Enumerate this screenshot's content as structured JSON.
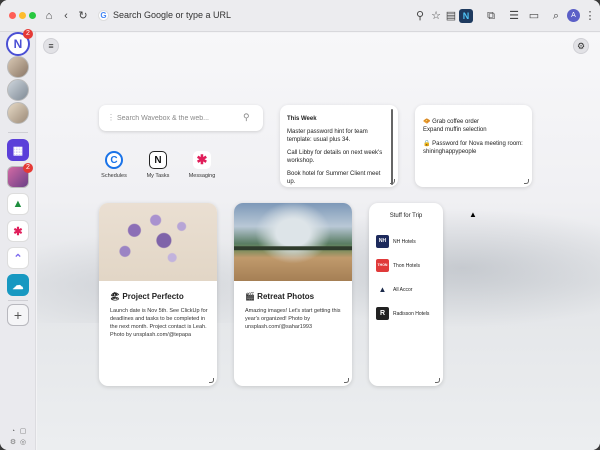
{
  "browser": {
    "omnibox_placeholder": "Search Google or type a URL",
    "google_glyph": "G",
    "extension_letter": "N",
    "profile_initial": "A",
    "icons": [
      "home-icon",
      "back-icon",
      "reload-icon",
      "zoom-icon",
      "star-icon",
      "wallet-icon",
      "extensions-icon",
      "tab-strip-icon",
      "download-icon",
      "search-icon"
    ]
  },
  "sidebar": {
    "logo_letter": "N",
    "logo_badge": "2",
    "app_badge": "2",
    "apps": [
      "Wavebox Spaces",
      "Google Drive",
      "Slack",
      "ClickUp",
      "Salesforce"
    ],
    "add_label": "+"
  },
  "dashboard": {
    "search_placeholder": "Search Wavebox & the web...",
    "shortcuts": [
      {
        "label": "Schedules",
        "icon": "webex-icon"
      },
      {
        "label": "My Tasks",
        "icon": "notion-icon"
      },
      {
        "label": "Messaging",
        "icon": "slack-icon"
      }
    ],
    "this_week": {
      "title": "This Week",
      "items": [
        "Master password hint for team template: usual plus 34.",
        "Call Libby for details on next week's workshop.",
        "Book hotel for Summer Client meet up."
      ]
    },
    "todo_note": {
      "line1": "🧇 Grab coffee order",
      "line2": "Expand muffin selection",
      "line3": "🔒 Password for Nova meeting room: shininghappypeople"
    },
    "project_card": {
      "title": "🏖 Project Perfecto",
      "body": "Launch date is Nov 5th. See ClickUp for deadlines and tasks to be completed in the next month. Project contact is Leah. Photo by unsplash.com/@tepapa"
    },
    "retreat_card": {
      "title": "🎬 Retreat Photos",
      "body": "Amazing images! Let's start getting this year's organized! Photo by unsplash.com/@sahar1993"
    },
    "trip_card": {
      "title": "Stuff for Trip",
      "items": [
        {
          "label": "NH Hotels",
          "logo": "NH",
          "color": "#1d2a5c"
        },
        {
          "label": "Thon Hotels",
          "logo": "THON",
          "color": "#e03a3a"
        },
        {
          "label": "All Accor",
          "logo": "▲",
          "color": "#1b2a4a"
        },
        {
          "label": "Radisson Hotels",
          "logo": "R",
          "color": "#222222"
        }
      ]
    }
  },
  "colors": {
    "accent": "#4a4fd4",
    "badge": "#e53935"
  }
}
